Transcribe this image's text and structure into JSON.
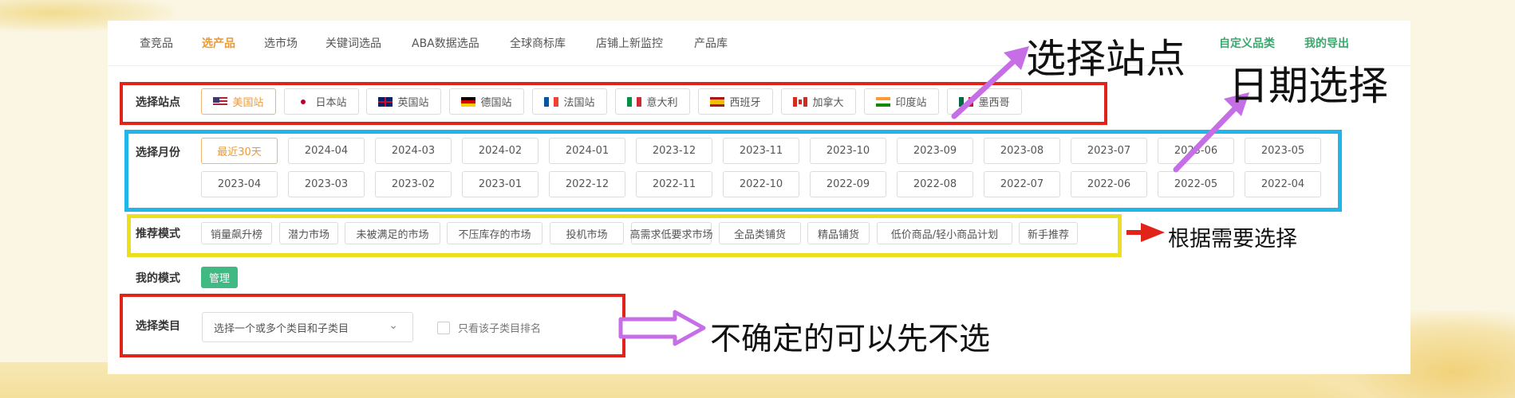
{
  "nav": {
    "items": [
      "查竞品",
      "选产品",
      "选市场",
      "关键词选品",
      "ABA数据选品",
      "全球商标库",
      "店铺上新监控",
      "产品库"
    ],
    "active_index": 1,
    "right_items": [
      "自定义品类",
      "我的导出"
    ]
  },
  "site": {
    "label": "选择站点",
    "options": [
      {
        "name": "美国站",
        "flag": "us"
      },
      {
        "name": "日本站",
        "flag": "jp"
      },
      {
        "name": "英国站",
        "flag": "gb"
      },
      {
        "name": "德国站",
        "flag": "de"
      },
      {
        "name": "法国站",
        "flag": "fr"
      },
      {
        "name": "意大利",
        "flag": "it"
      },
      {
        "name": "西班牙",
        "flag": "es"
      },
      {
        "name": "加拿大",
        "flag": "ca"
      },
      {
        "name": "印度站",
        "flag": "in"
      },
      {
        "name": "墨西哥",
        "flag": "mx"
      }
    ],
    "selected_index": 0
  },
  "month": {
    "label": "选择月份",
    "row1": [
      "最近30天",
      "2024-04",
      "2024-03",
      "2024-02",
      "2024-01",
      "2023-12",
      "2023-11",
      "2023-10",
      "2023-09",
      "2023-08",
      "2023-07",
      "2023-06",
      "2023-05"
    ],
    "row2": [
      "2023-04",
      "2023-03",
      "2023-02",
      "2023-01",
      "2022-12",
      "2022-11",
      "2022-10",
      "2022-09",
      "2022-08",
      "2022-07",
      "2022-06",
      "2022-05",
      "2022-04"
    ],
    "selected": "最近30天"
  },
  "mode": {
    "label": "推荐模式",
    "options": [
      "销量飙升榜",
      "潜力市场",
      "未被满足的市场",
      "不压库存的市场",
      "投机市场",
      "高需求低要求市场",
      "全品类铺货",
      "精品铺货",
      "低价商品/轻小商品计划",
      "新手推荐"
    ]
  },
  "my_mode": {
    "label": "我的模式",
    "button": "管理"
  },
  "category": {
    "label": "选择类目",
    "placeholder": "选择一个或多个类目和子类目",
    "checkbox_label": "只看该子类目排名"
  },
  "annotations": {
    "site": "选择站点",
    "date": "日期选择",
    "mode": "根据需要选择",
    "category": "不确定的可以先不选"
  },
  "colors": {
    "accent": "#e89a3b",
    "green": "#40b982",
    "red_box": "#e2231a",
    "blue_box": "#1fb6ea",
    "yellow_box": "#ecdf1e",
    "purple_arrow": "#c56ee6"
  }
}
